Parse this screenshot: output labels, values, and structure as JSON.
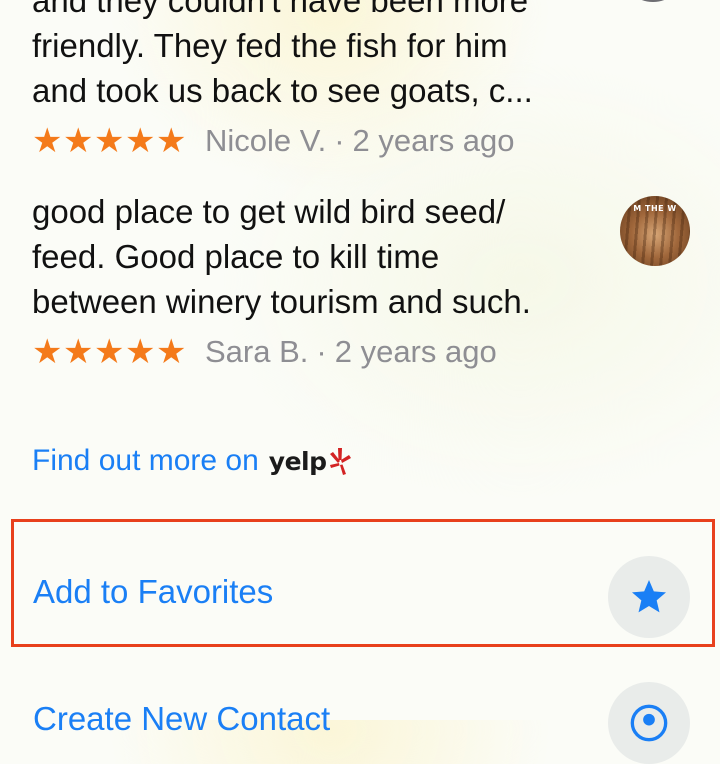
{
  "reviews": [
    {
      "text": "and they couldn't have been more\nfriendly. They fed the fish for him\nand took us back to see goats, c...",
      "rating": 5,
      "author": "Nicole V.",
      "separator": "·",
      "time": "2 years ago"
    },
    {
      "text": "good place to get wild bird seed/\nfeed. Good place to kill time\nbetween winery tourism and such.",
      "rating": 5,
      "author": "Sara B.",
      "separator": "·",
      "time": "2 years ago",
      "avatar_text": "M THE W"
    }
  ],
  "star_glyph": "★",
  "yelp": {
    "link_text": "Find out more on",
    "logo_text": "yelp"
  },
  "actions": {
    "favorites_label": "Add to Favorites",
    "contact_label": "Create New Contact"
  },
  "colors": {
    "link_blue": "#1a7ff5",
    "star_orange": "#f47a1a",
    "highlight_red": "#e8401c",
    "yelp_red": "#d32323"
  },
  "icons": {
    "favorites": "star-icon",
    "contact": "person-icon"
  }
}
